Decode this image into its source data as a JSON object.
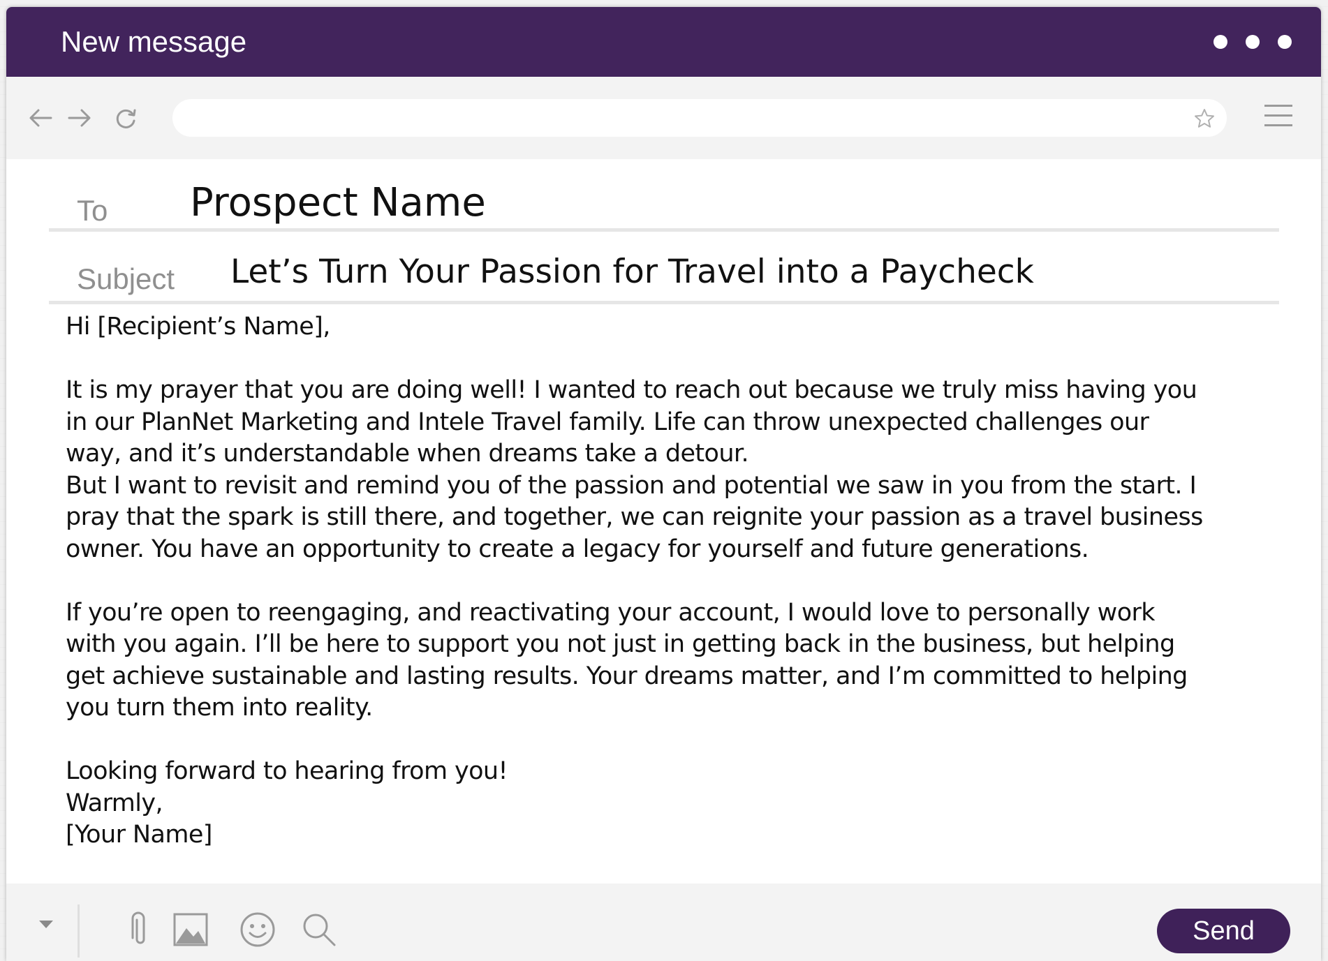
{
  "window": {
    "title": "New message",
    "menu_icon": "more-dots-icon"
  },
  "toolbar": {
    "back_icon": "arrow-left-icon",
    "forward_icon": "arrow-right-icon",
    "reload_icon": "reload-icon",
    "address_value": "",
    "bookmark_icon": "star-icon",
    "menu_icon": "hamburger-menu-icon"
  },
  "compose": {
    "to_label": "To",
    "to_value": "Prospect Name",
    "subject_label": "Subject",
    "subject_value": "Let’s Turn Your Passion for Travel into a Paycheck",
    "body": {
      "greeting": "Hi [Recipient’s Name],",
      "p1_l1": "It is my prayer that you are doing well! I wanted to reach out because we truly miss having you",
      "p1_l2": "in our PlanNet Marketing and Intele Travel family. Life can throw unexpected challenges our",
      "p1_l3": "way, and it’s understandable when dreams take a detour.",
      "p2_l1": "But I want to revisit and remind you of the passion and potential we saw in you from the start. I",
      "p2_l2": "pray that the spark is still there, and together, we can reignite your passion as a travel business",
      "p2_l3": "owner. You have an opportunity to create a legacy for yourself and future generations.",
      "p3_l1": "If you’re open to reengaging, and reactivating your account, I would love to personally work",
      "p3_l2": "with you again. I’ll be here to support you not just in getting back in the business, but helping",
      "p3_l3": "get achieve sustainable and lasting results. Your dreams matter, and I’m committed to helping",
      "p3_l4": "you turn them into reality.",
      "closing": "Looking forward to hearing from you!",
      "signoff": "Warmly,",
      "signature": "[Your Name]"
    }
  },
  "bottombar": {
    "format_toggle_icon": "caret-down-icon",
    "attach_icon": "paperclip-icon",
    "image_icon": "image-icon",
    "emoji_icon": "smiley-icon",
    "search_icon": "search-icon",
    "send_label": "Send"
  },
  "colors": {
    "titlebar": "#42245c",
    "send_button": "#3f2159",
    "toolbar_bg": "#f3f3f3",
    "icon_gray": "#9a9a9a"
  }
}
